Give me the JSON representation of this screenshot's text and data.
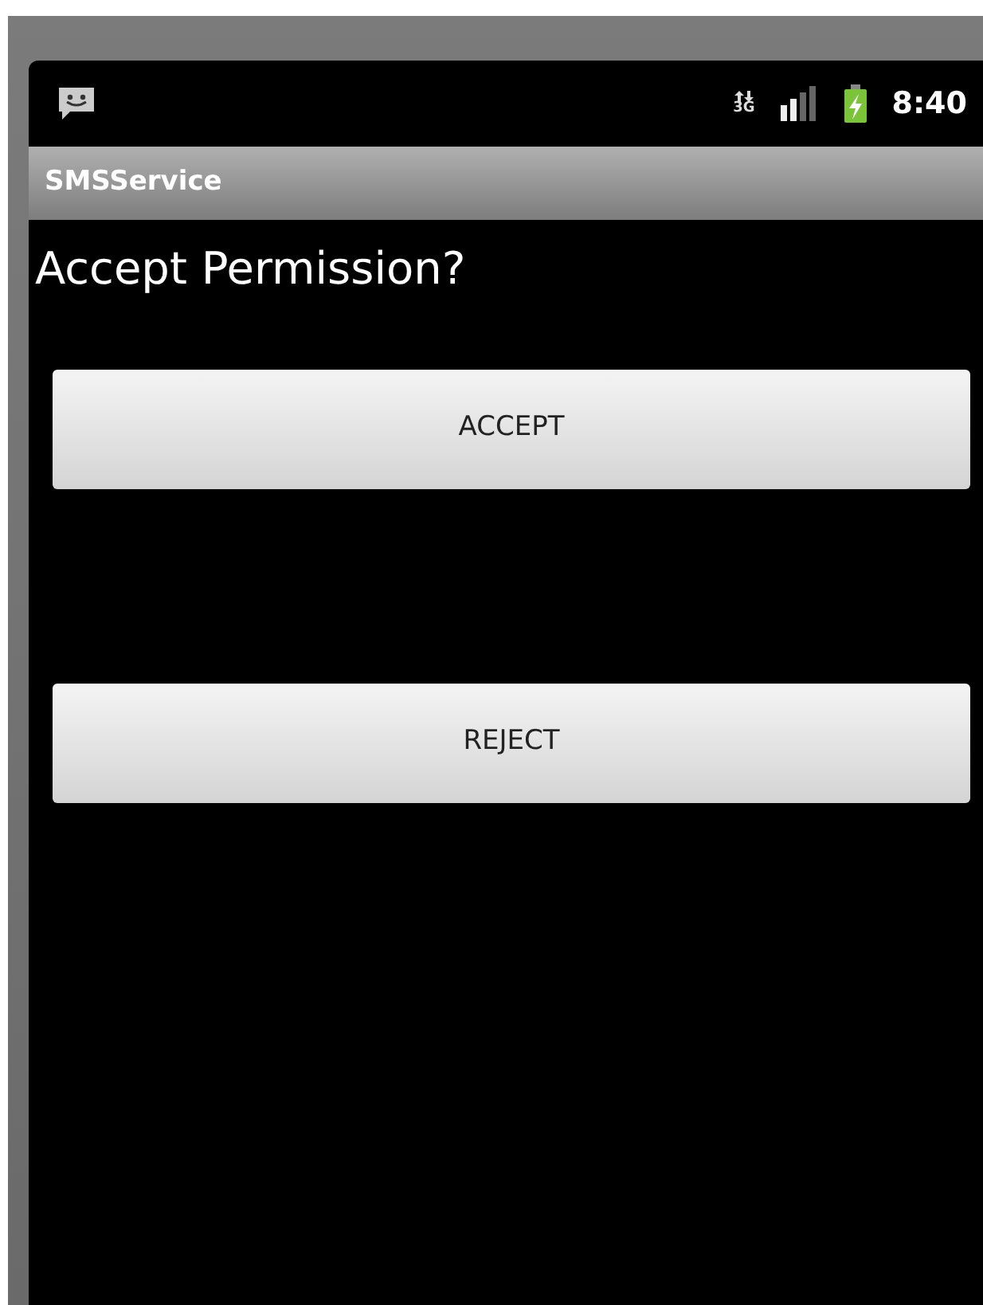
{
  "status_bar": {
    "network_type": "3G",
    "time": "8:40"
  },
  "title_bar": {
    "title": "SMSService"
  },
  "heading": "Accept Permission?",
  "buttons": [
    {
      "label": "ACCEPT"
    },
    {
      "label": "REJECT"
    }
  ]
}
